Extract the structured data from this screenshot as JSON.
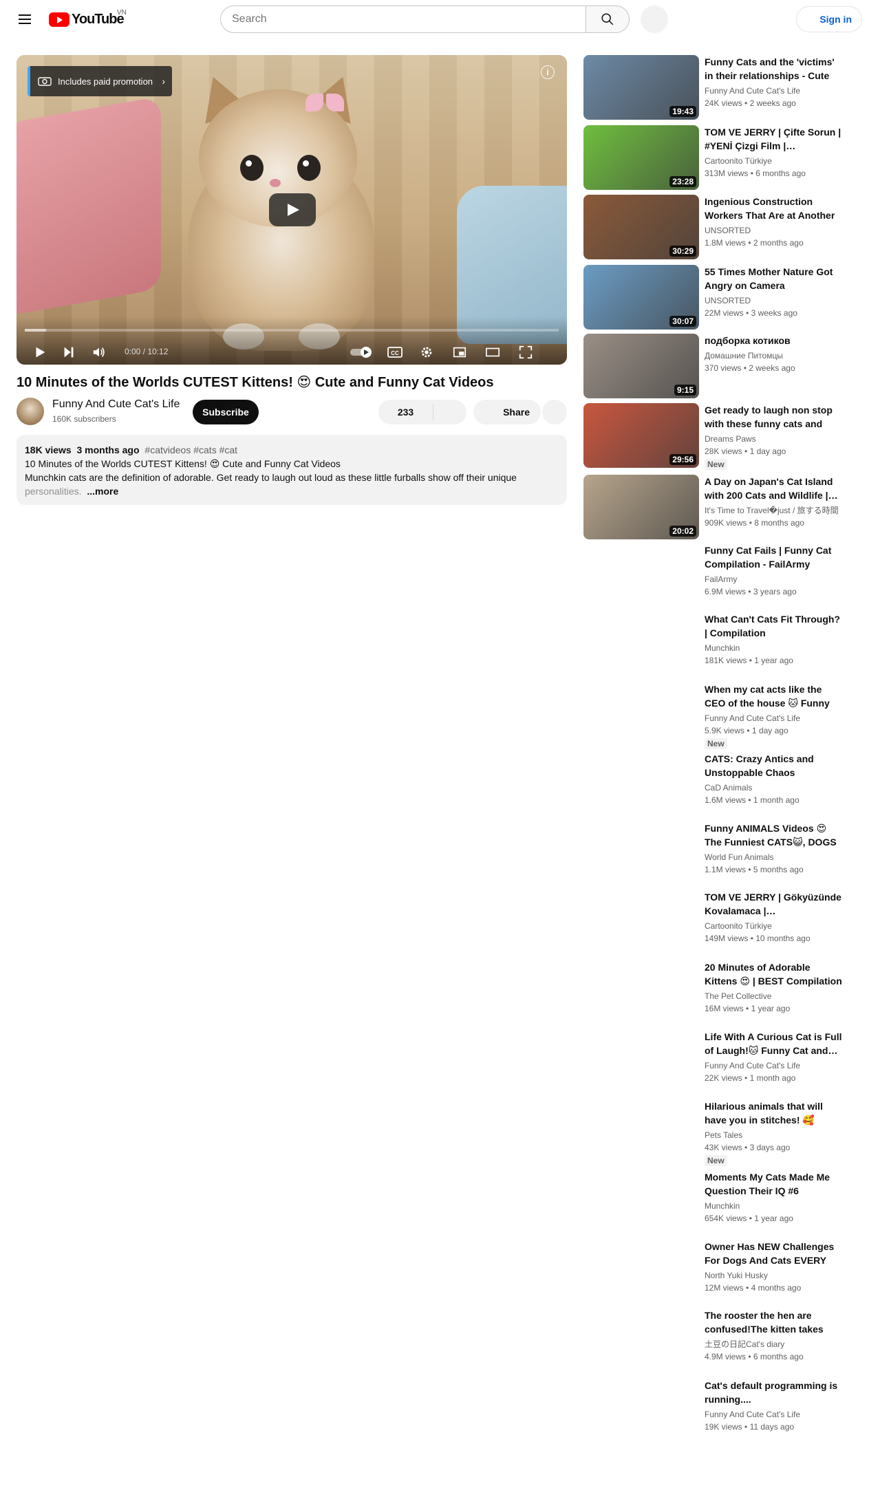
{
  "header": {
    "logo_text": "YouTube",
    "country": "VN",
    "search_placeholder": "Search",
    "sign_in": "Sign in"
  },
  "player": {
    "promo_label": "Includes paid promotion",
    "info": "i",
    "time": "0:00 / 10:12",
    "progress_buffered": 0.04,
    "icons": [
      "play-icon",
      "next-icon",
      "volume-icon",
      "autoplay-toggle-icon",
      "captions-icon",
      "settings-icon",
      "miniplayer-icon",
      "theater-icon",
      "fullscreen-icon"
    ]
  },
  "video": {
    "title": "10 Minutes of the Worlds CUTEST Kittens! 😍 Cute and Funny Cat Videos",
    "channel": "Funny And Cute Cat's Life",
    "subscribers": "160K subscribers",
    "subscribe_label": "Subscribe",
    "likes": "233",
    "share_label": "Share"
  },
  "description": {
    "views": "18K views",
    "age": "3 months ago",
    "tags": "#catvideos #cats #cat",
    "line1": "10 Minutes of the Worlds CUTEST Kittens! 😍 Cute and Funny Cat Videos",
    "line2": "Munchkin cats are the definition of adorable. Get ready to laugh out loud as these little furballs show off their unique",
    "line3": "personalities.",
    "more": "...more"
  },
  "recommendations": [
    {
      "title": "Funny Cats and the 'victims' in their relationships - Cute Cat…",
      "channel": "Funny And Cute Cat's Life",
      "views": "24K views",
      "age": "2 weeks ago",
      "duration": "19:43",
      "badge": "",
      "thumb": "#6d8aa6"
    },
    {
      "title": "TOM VE JERRY | Çifte Sorun | #YENİ Çizgi Film |…",
      "channel": "Cartoonito Türkiye",
      "views": "313M views",
      "age": "6 months ago",
      "duration": "23:28",
      "badge": "",
      "thumb": "#6fbf3f"
    },
    {
      "title": "Ingenious Construction Workers That Are at Another Level",
      "channel": "UNSORTED",
      "views": "1.8M views",
      "age": "2 months ago",
      "duration": "30:29",
      "badge": "",
      "thumb": "#8b5a3a"
    },
    {
      "title": "55 Times Mother Nature Got Angry on Camera",
      "channel": "UNSORTED",
      "views": "22M views",
      "age": "3 weeks ago",
      "duration": "30:07",
      "badge": "",
      "thumb": "#6b9cc4"
    },
    {
      "title": "подборка котиков",
      "channel": "Домашние Питомцы",
      "views": "370 views",
      "age": "2 weeks ago",
      "duration": "9:15",
      "badge": "",
      "thumb": "#9a8f86"
    },
    {
      "title": "Get ready to laugh non stop with these funny cats and dogs 🤣",
      "channel": "Dreams Paws",
      "views": "28K views",
      "age": "1 day ago",
      "duration": "29:56",
      "badge": "New",
      "thumb": "#c9573f"
    },
    {
      "title": "A Day on Japan's Cat Island with 200 Cats and Wildlife |…",
      "channel": "It's Time to Travel�just / 旅する時間",
      "views": "909K views",
      "age": "8 months ago",
      "duration": "20:02",
      "badge": "",
      "thumb": "#b7a58c"
    },
    {
      "title": "Funny Cat Fails | Funny Cat Compilation - FailArmy",
      "channel": "FailArmy",
      "views": "6.9M views",
      "age": "3 years ago",
      "duration": "",
      "badge": "",
      "thumb": ""
    },
    {
      "title": "What Can't Cats Fit Through? | Compilation",
      "channel": "Munchkin",
      "views": "181K views",
      "age": "1 year ago",
      "duration": "",
      "badge": "",
      "thumb": ""
    },
    {
      "title": "When my cat acts like the CEO of the house 🐱 Funny Cat an…",
      "channel": "Funny And Cute Cat's Life",
      "views": "5.9K views",
      "age": "1 day ago",
      "duration": "",
      "badge": "New",
      "thumb": ""
    },
    {
      "title": "CATS: Crazy Antics and Unstoppable Chaos",
      "channel": "CaD Animals",
      "views": "1.6M views",
      "age": "1 month ago",
      "duration": "",
      "badge": "",
      "thumb": ""
    },
    {
      "title": "Funny ANIMALS Videos 😍 The Funniest CATS😺, DOGS 🐶…",
      "channel": "World Fun Animals",
      "views": "1.1M views",
      "age": "5 months ago",
      "duration": "",
      "badge": "",
      "thumb": ""
    },
    {
      "title": "TOM VE JERRY | Gökyüzünde Kovalamaca |…",
      "channel": "Cartoonito Türkiye",
      "views": "149M views",
      "age": "10 months ago",
      "duration": "",
      "badge": "",
      "thumb": ""
    },
    {
      "title": "20 Minutes of Adorable Kittens 😍 | BEST Compilation",
      "channel": "The Pet Collective",
      "views": "16M views",
      "age": "1 year ago",
      "duration": "",
      "badge": "",
      "thumb": ""
    },
    {
      "title": "Life With A Curious Cat is Full of Laugh!🐱 Funny Cat and…",
      "channel": "Funny And Cute Cat's Life",
      "views": "22K views",
      "age": "1 month ago",
      "duration": "",
      "badge": "",
      "thumb": ""
    },
    {
      "title": "Hilarious animals that will have you in stitches! 🥰",
      "channel": "Pets Tales",
      "views": "43K views",
      "age": "3 days ago",
      "duration": "",
      "badge": "New",
      "thumb": ""
    },
    {
      "title": "Moments My Cats Made Me Question Their IQ #6",
      "channel": "Munchkin",
      "views": "654K views",
      "age": "1 year ago",
      "duration": "",
      "badge": "",
      "thumb": ""
    },
    {
      "title": "Owner Has NEW Challenges For Dogs And Cats EVERY DAY",
      "channel": "North Yuki Husky",
      "views": "12M views",
      "age": "4 months ago",
      "duration": "",
      "badge": "",
      "thumb": ""
    },
    {
      "title": "The rooster the hen are confused!The kitten takes the…",
      "channel": "土豆の日記Cat's diary",
      "views": "4.9M views",
      "age": "6 months ago",
      "duration": "",
      "badge": "",
      "thumb": ""
    },
    {
      "title": "Cat's default programming is running....",
      "channel": "Funny And Cute Cat's Life",
      "views": "19K views",
      "age": "11 days ago",
      "duration": "",
      "badge": "",
      "thumb": ""
    }
  ]
}
